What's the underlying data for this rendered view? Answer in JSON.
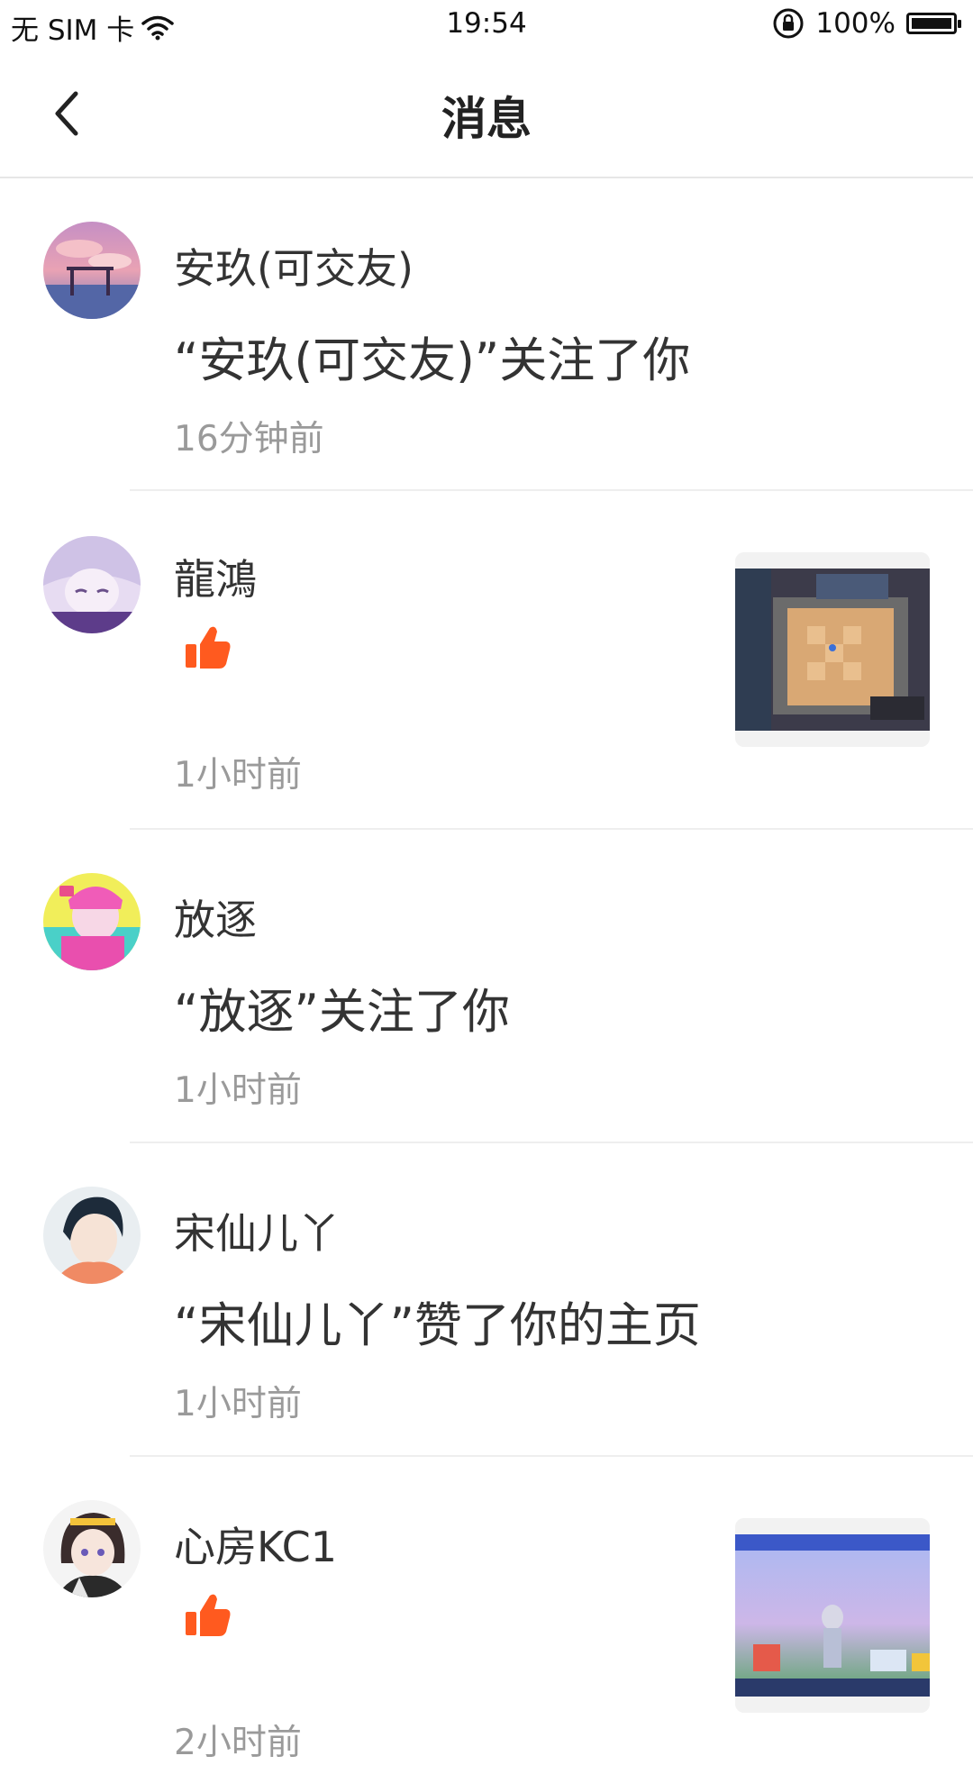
{
  "status_bar": {
    "carrier": "无 SIM 卡",
    "time": "19:54",
    "battery": "100%"
  },
  "nav": {
    "title": "消息"
  },
  "messages": [
    {
      "name": "安玖(可交友)",
      "content": "“安玖(可交友)”关注了你",
      "time": "16分钟前",
      "type": "follow"
    },
    {
      "name": "龍鴻",
      "content": "",
      "time": "1小时前",
      "type": "like"
    },
    {
      "name": "放逐",
      "content": "“放逐”关注了你",
      "time": "1小时前",
      "type": "follow"
    },
    {
      "name": "宋仙儿丫",
      "content": "“宋仙儿丫”赞了你的主页",
      "time": "1小时前",
      "type": "like_profile"
    },
    {
      "name": "心房KC1",
      "content": "",
      "time": "2小时前",
      "type": "like"
    }
  ],
  "colors": {
    "accent": "#ff5a1f",
    "divider": "#eeeeee",
    "time_text": "#9a9a9a"
  },
  "icons": {
    "back": "chevron-left-icon",
    "like": "thumbs-up-icon",
    "wifi": "wifi-icon",
    "lock": "rotation-lock-icon"
  }
}
